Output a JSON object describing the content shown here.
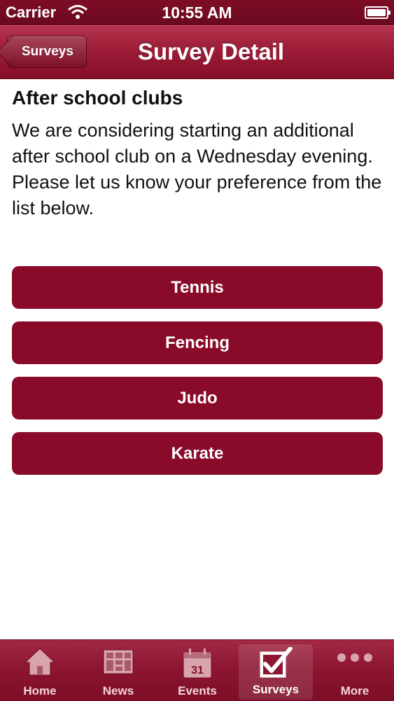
{
  "status_bar": {
    "carrier": "Carrier",
    "time": "10:55 AM"
  },
  "nav": {
    "back_label": "Surveys",
    "title": "Survey Detail"
  },
  "survey": {
    "title": "After school clubs",
    "description": "We are considering starting an additional after school club on a Wednesday evening. Please let us know your preference from the list below.",
    "options": [
      "Tennis",
      "Fencing",
      "Judo",
      "Karate"
    ]
  },
  "tabs": [
    {
      "label": "Home",
      "icon": "home-icon",
      "selected": false
    },
    {
      "label": "News",
      "icon": "news-icon",
      "selected": false
    },
    {
      "label": "Events",
      "icon": "calendar-icon",
      "icon_text": "31",
      "selected": false
    },
    {
      "label": "Surveys",
      "icon": "checkbox-icon",
      "selected": true
    },
    {
      "label": "More",
      "icon": "more-icon",
      "selected": false
    }
  ],
  "colors": {
    "brand": "#8a0a2a",
    "nav": "#9d1d37",
    "status_bar": "#7e0c25"
  }
}
